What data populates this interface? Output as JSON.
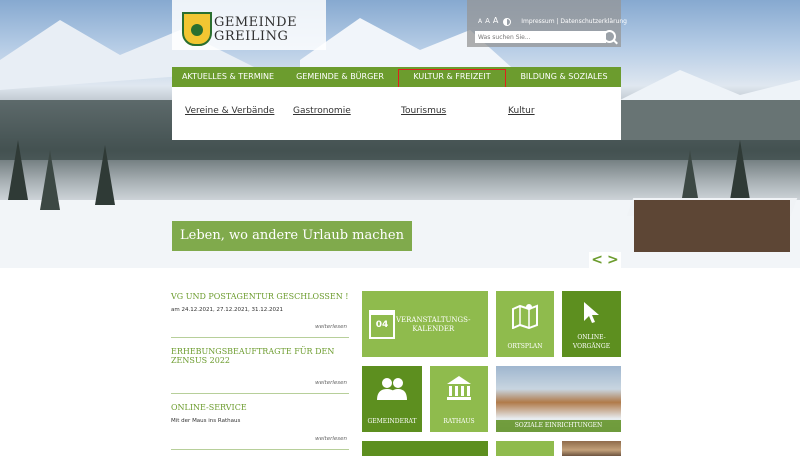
{
  "logo": {
    "line1": "GEMEINDE",
    "line2": "GREILING"
  },
  "utility": {
    "font_sizes": [
      "A",
      "A",
      "A"
    ],
    "contrast_icon": "contrast-icon",
    "links": "Impressum | Datenschutzerklärung",
    "search_placeholder": "Was suchen Sie..."
  },
  "nav": {
    "items": [
      {
        "label": "AKTUELLES & TERMINE"
      },
      {
        "label": "GEMEINDE & BÜRGER"
      },
      {
        "label": "KULTUR & FREIZEIT"
      },
      {
        "label": "BILDUNG & SOZIALES"
      }
    ]
  },
  "dropdown": {
    "items": [
      {
        "label": "Vereine & Verbände"
      },
      {
        "label": "Gastronomie"
      },
      {
        "label": "Tourismus"
      },
      {
        "label": "Kultur"
      }
    ]
  },
  "hero": {
    "slogan": "Leben, wo andere Urlaub machen",
    "prev": "<",
    "next": ">"
  },
  "news": [
    {
      "title": "VG UND POSTAGENTUR GESCHLOSSEN !",
      "text": "am 24.12.2021, 27.12.2021, 31.12.2021",
      "more": "weiterlesen"
    },
    {
      "title": "ERHEBUNGSBEAUFTRAGTE FÜR DEN ZENSUS 2022",
      "text": "",
      "more": "weiterlesen"
    },
    {
      "title": "ONLINE-SERVICE",
      "text": "Mit der Maus ins Rathaus",
      "more": "weiterlesen"
    }
  ],
  "tiles": {
    "calendar": {
      "label1": "VERANSTALTUNGS-",
      "label2": "KALENDER",
      "day": "04"
    },
    "map": {
      "label": "ORTSPLAN"
    },
    "online": {
      "label1": "ONLINE-",
      "label2": "VORGÄNGE"
    },
    "council": {
      "label": "GEMEINDERAT"
    },
    "townhall": {
      "label": "RATHAUS"
    },
    "social": {
      "label": "SOZIALE EINRICHTUNGEN"
    }
  },
  "colors": {
    "green": "#6c9c2e",
    "light_green": "#8fbb4d",
    "dark_green": "#5d8f1f",
    "active_outline": "#e0201c"
  }
}
